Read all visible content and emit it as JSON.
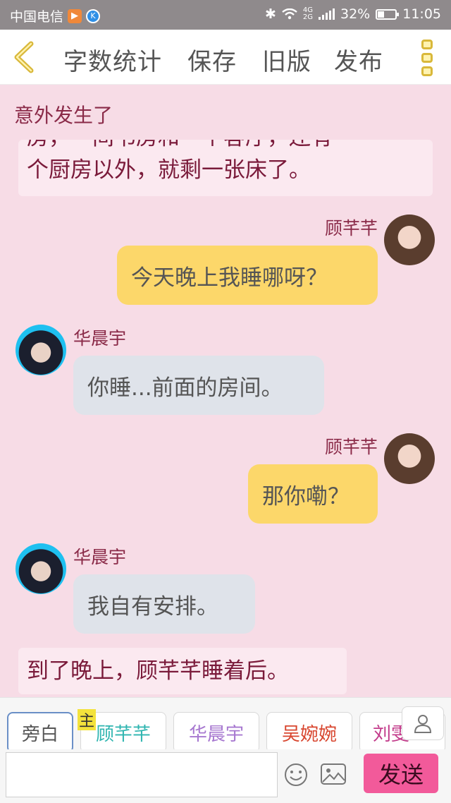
{
  "status_bar": {
    "carrier": "中国电信",
    "network": "4G\n2G",
    "battery": "32%",
    "time": "11:05"
  },
  "nav": {
    "items": [
      "字数统计",
      "保存",
      "旧版",
      "发布"
    ]
  },
  "chapter_title": "意外发生了",
  "messages": {
    "narration_top_cut": "房，一间书房和一个客厅，还有一",
    "narration_top": "个厨房以外，就剩一张床了。",
    "m1_name": "顾芊芊",
    "m1_text": "今天晚上我睡哪呀？",
    "m2_name": "华晨宇",
    "m2_text": "你睡...前面的房间。",
    "m3_name": "顾芊芊",
    "m3_text": "那你嘞？",
    "m4_name": "华晨宇",
    "m4_text": "我自有安排。",
    "narration_bottom": "到了晚上，顾芊芊睡着后。"
  },
  "roles": {
    "narrator": "旁白",
    "main_badge": "主",
    "r1": "顾芊芊",
    "r2": "华晨宇",
    "r3": "吴婉婉",
    "r4": "刘雯"
  },
  "input": {
    "placeholder": "",
    "send": "发送"
  },
  "colors": {
    "background": "#f7dce6",
    "accent_yellow": "#fcd76a",
    "send_pink": "#f25a9a",
    "role_teal": "#2fb5b0",
    "role_purple": "#a778d0",
    "role_red": "#d8462f",
    "role_magenta": "#c23a8a"
  }
}
